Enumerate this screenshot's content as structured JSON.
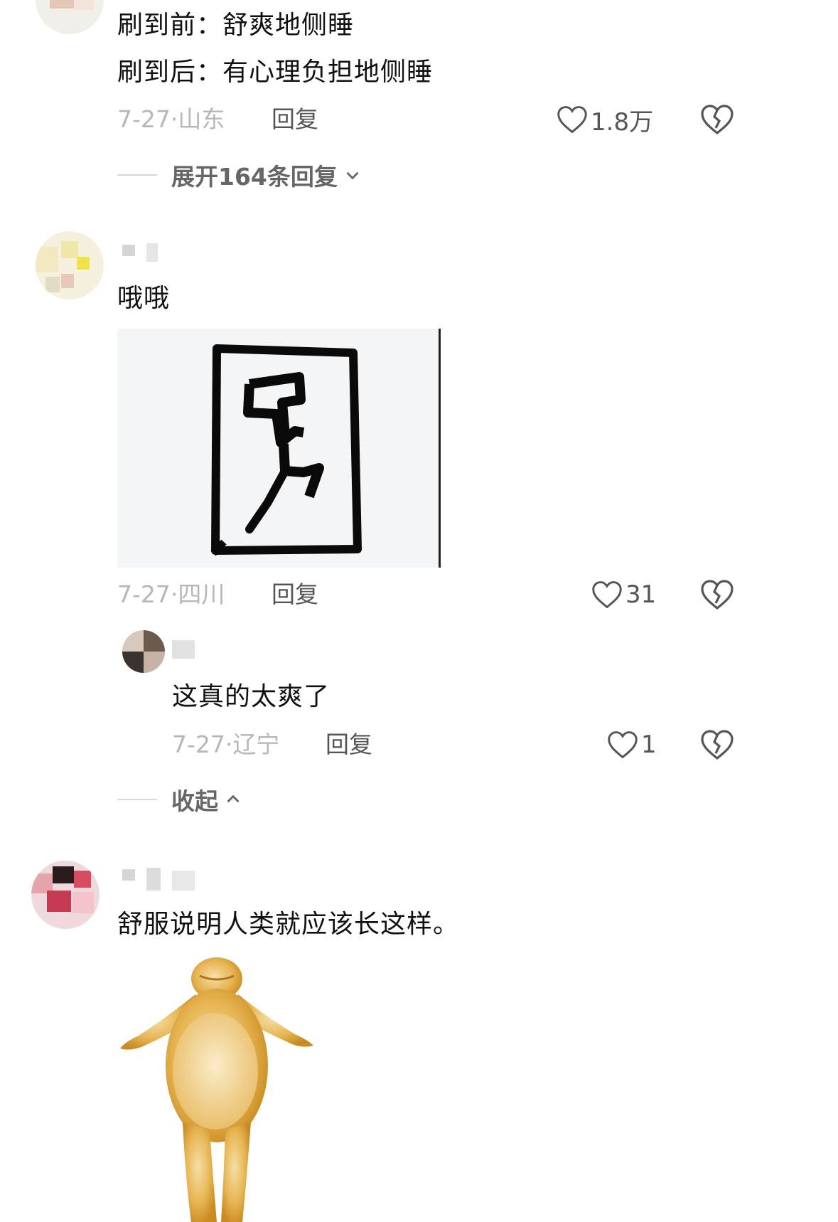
{
  "comments": [
    {
      "line1": "刷到前：舒爽地侧睡",
      "line2": "刷到后：有心理负担地侧睡",
      "date": "7-27",
      "location": "山东",
      "reply_label": "回复",
      "likes": "1.8万",
      "expand_label": "展开164条回复"
    },
    {
      "text": "哦哦",
      "date": "7-27",
      "location": "四川",
      "reply_label": "回复",
      "likes": "31",
      "reply": {
        "text": "这真的太爽了",
        "date": "7-27",
        "location": "辽宁",
        "reply_label": "回复",
        "likes": "1"
      },
      "collapse_label": "收起"
    },
    {
      "text": "舒服说明人类就应该长这样。"
    }
  ]
}
